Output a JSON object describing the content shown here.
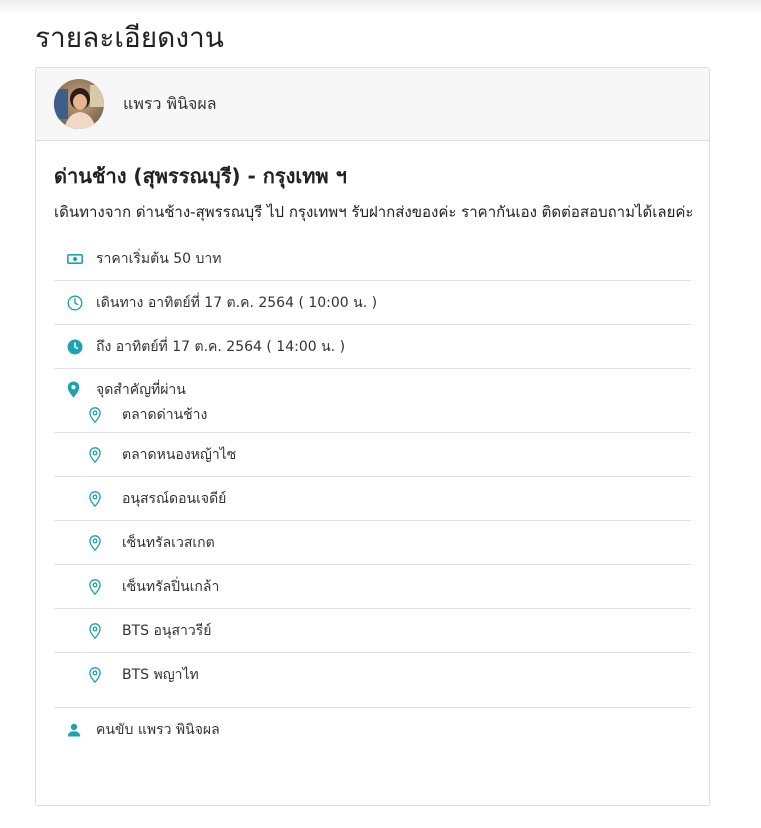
{
  "page": {
    "title": "รายละเอียดงาน"
  },
  "driver": {
    "name": "แพรว พินิจผล"
  },
  "trip": {
    "title": "ด่านช้าง (สุพรรณบุรี) - กรุงเทพ ฯ",
    "description": "เดินทางจาก ด่านช้าง-สุพรรณบุรี ไป กรุงเทพฯ รับฝากส่งของค่ะ ราคากันเอง ติดต่อสอบถามได้เลยค่ะ"
  },
  "info": {
    "price": "ราคาเริ่มต้น 50 บาท",
    "departure": "เดินทาง อาทิตย์ที่ 17 ต.ค. 2564 ( 10:00 น. )",
    "arrival": "ถึง อาทิตย์ที่ 17 ต.ค. 2564 ( 14:00 น. )",
    "waypoints_label": "จุดสำคัญที่ผ่าน",
    "driver_label": "คนขับ แพรว พินิจผล"
  },
  "waypoints": [
    "ตลาดด่านช้าง",
    "ตลาดหนองหญ้าไซ",
    "อนุสรณ์ดอนเจดีย์",
    "เซ็นทรัลเวสเกต",
    "เซ็นทรัลปิ่นเกล้า",
    "BTS อนุสาวรีย์",
    "BTS พญาไท"
  ],
  "icons": {
    "price": "cash-icon",
    "departure": "clock-outline-icon",
    "arrival": "clock-filled-icon",
    "waypoints": "map-pin-filled-icon",
    "waypoint": "map-pin-outline-icon",
    "driver": "user-icon"
  },
  "colors": {
    "accent": "#1ba3b4"
  }
}
